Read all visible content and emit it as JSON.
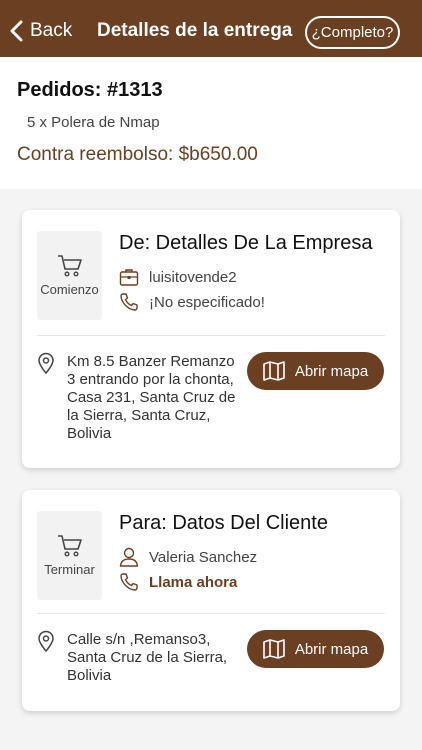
{
  "header": {
    "back_label": "Back",
    "title": "Detalles de la entrega",
    "complete_label": "¿Completo?"
  },
  "order": {
    "number": "Pedidos: #1313",
    "item": "5 x Polera de Nmap",
    "payment": "Contra reembolso: $b650.00"
  },
  "pickup": {
    "status_icon": "cart-icon",
    "status_label": "Comienzo",
    "title": "De: Detalles De La Empresa",
    "name_icon": "briefcase-icon",
    "name": "luisitovende2",
    "phone_icon": "phone-icon",
    "phone": "¡No especificado!",
    "address": "Km 8.5 Banzer Remanzo 3 entrando por la chonta, Casa 231, Santa Cruz de la Sierra, Santa Cruz, Bolivia",
    "map_label": "Abrir mapa"
  },
  "dropoff": {
    "status_icon": "cart-icon",
    "status_label": "Terminar",
    "title": "Para: Datos Del Cliente",
    "name_icon": "user-icon",
    "name": "Valeria Sanchez",
    "phone_icon": "phone-icon",
    "phone": "Llama ahora",
    "address": "Calle s/n ,Remanso3, Santa Cruz de la Sierra, Bolivia",
    "map_label": "Abrir mapa"
  },
  "colors": {
    "brand": "#6b3f22",
    "background": "#f4f4f4",
    "card": "#ffffff"
  }
}
